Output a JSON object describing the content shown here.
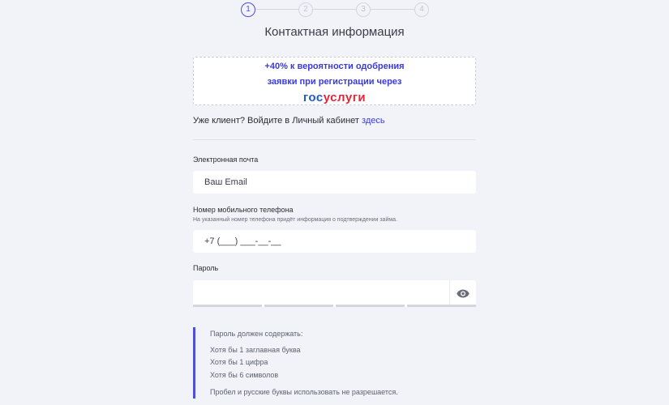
{
  "stepper": {
    "steps": [
      "1",
      "2",
      "3",
      "4"
    ],
    "active_step": 1
  },
  "page_title": "Контактная информация",
  "promo": {
    "line1": "+40% к вероятности одобрения",
    "line2": "заявки при регистрации через",
    "logo_part1": "гос",
    "logo_part2": "услуги"
  },
  "login": {
    "text": "Уже клиент? Войдите в Личный кабинет",
    "link": "здесь"
  },
  "email": {
    "label": "Электронная почта",
    "placeholder": "Ваш Email"
  },
  "phone": {
    "label": "Номер мобильного телефона",
    "hint": "На указанный номер телефона придёт информация о подтверждении займа.",
    "value": "+7 (___) ___-__-__"
  },
  "password": {
    "label": "Пароль",
    "value": "",
    "strength_segments_filled": 0,
    "strength_segments_total": 4
  },
  "password_rules": {
    "title": "Пароль должен содержать:",
    "items": [
      "Хотя бы 1 заглавная буква",
      "Хотя бы 1 цифра",
      "Хотя бы 6 символов"
    ],
    "note": "Пробел и русские буквы использовать не разрешается."
  },
  "colors": {
    "accent": "#4f50d8",
    "link": "#3a3ae0",
    "background": "#f1f3f8",
    "gos_blue": "#1f5bc6",
    "gos_red": "#e2263a"
  }
}
